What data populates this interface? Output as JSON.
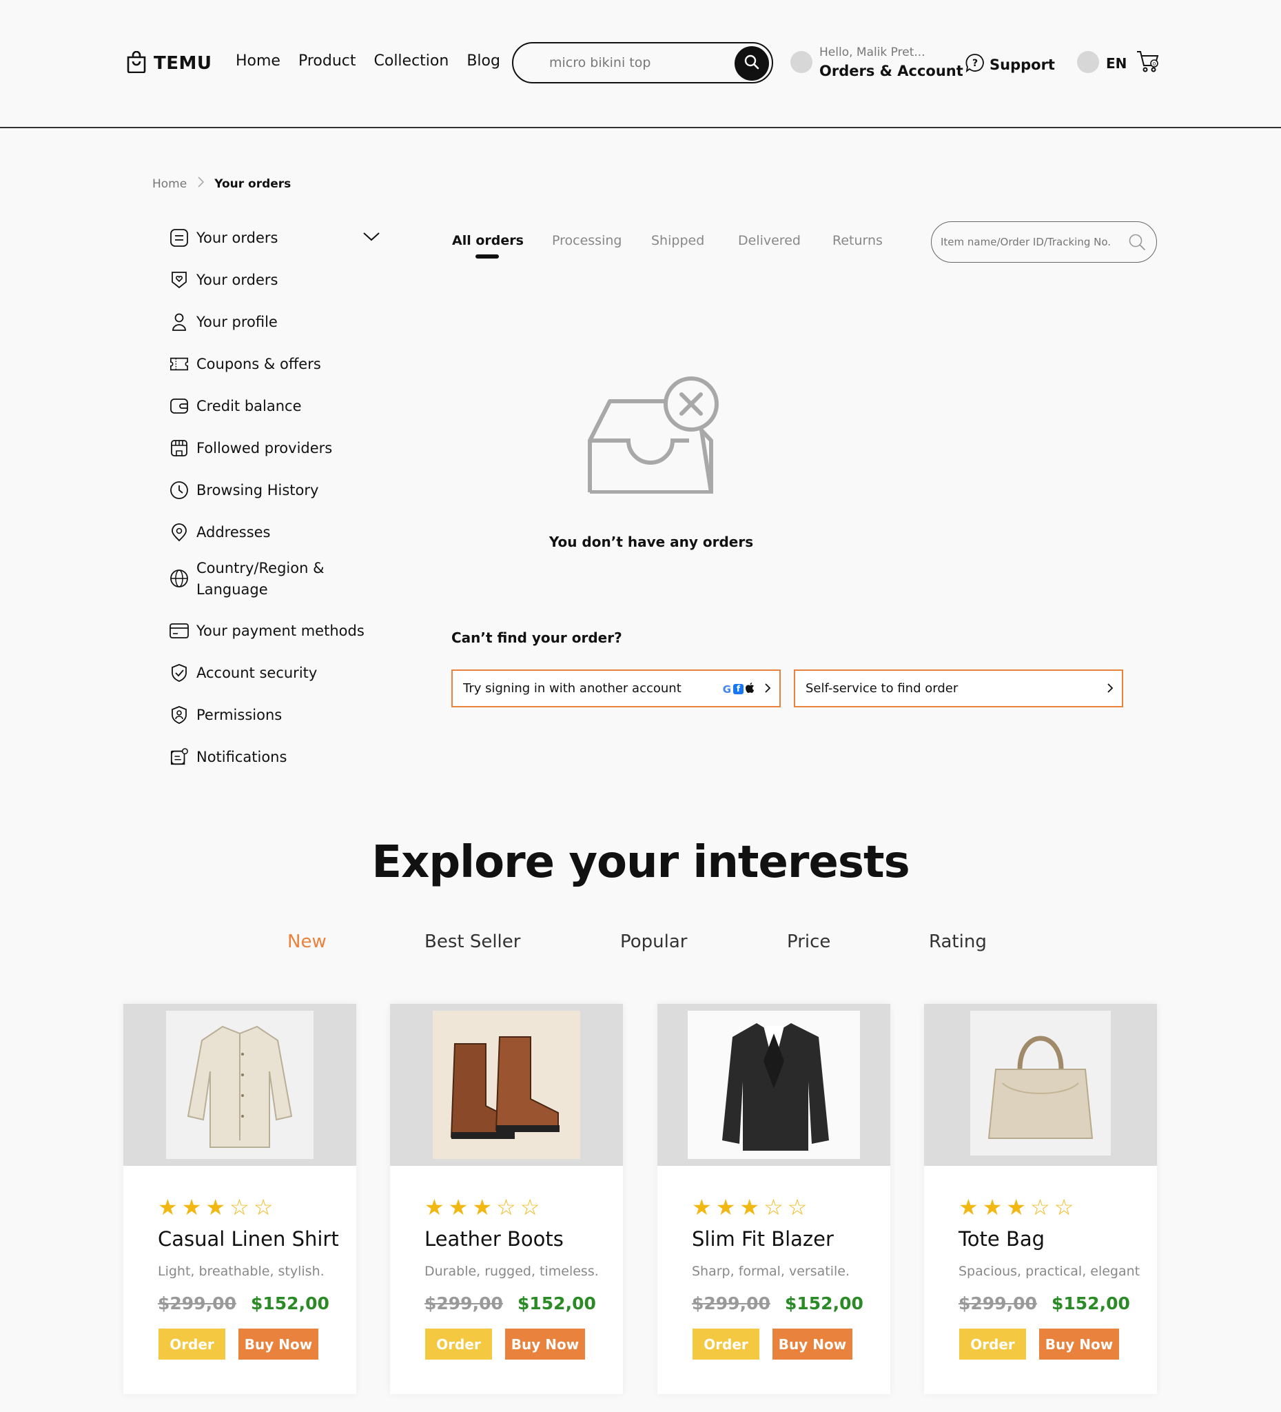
{
  "header": {
    "logo": "TEMU",
    "nav": [
      "Home",
      "Product",
      "Collection",
      "Blog"
    ],
    "search_value": "micro bikini top",
    "greeting": "Hello, Malik Pret...",
    "account_label": "Orders & Account",
    "support_label": "Support",
    "language": "EN"
  },
  "breadcrumb": {
    "home": "Home",
    "current": "Your orders"
  },
  "sidebar": {
    "items": [
      {
        "label": "Your orders",
        "icon": "order-list-icon"
      },
      {
        "label": "Your orders",
        "icon": "heart-shield-icon"
      },
      {
        "label": "Your profile",
        "icon": "user-icon"
      },
      {
        "label": "Coupons & offers",
        "icon": "ticket-icon"
      },
      {
        "label": "Credit balance",
        "icon": "wallet-icon"
      },
      {
        "label": "Followed providers",
        "icon": "store-icon"
      },
      {
        "label": "Browsing History",
        "icon": "clock-icon"
      },
      {
        "label": "Addresses",
        "icon": "location-pin-icon"
      },
      {
        "label": "Country/Region & Language",
        "icon": "globe-icon"
      },
      {
        "label": "Your payment methods",
        "icon": "card-icon"
      },
      {
        "label": "Account security",
        "icon": "shield-check-icon"
      },
      {
        "label": "Permissions",
        "icon": "shield-user-icon"
      },
      {
        "label": "Notifications",
        "icon": "message-icon"
      }
    ]
  },
  "orders": {
    "tabs": [
      "All orders",
      "Processing",
      "Shipped",
      "Delivered",
      "Returns"
    ],
    "search_placeholder": "Item name/Order ID/Tracking No.",
    "empty_text": "You don’t have any orders",
    "cant_find": "Can’t find your order?",
    "help_signin": "Try signing in with another account",
    "help_self_service": "Self-service to find order"
  },
  "explore": {
    "title": "Explore your interests",
    "filters": [
      "New",
      "Best Seller",
      "Popular",
      "Price",
      "Rating"
    ],
    "active_filter": "New",
    "order_label": "Order",
    "buy_label": "Buy Now",
    "products": [
      {
        "name": "Casual Linen Shirt",
        "desc": "Light, breathable, stylish.",
        "old_price": "$299,00",
        "price": "$152,00",
        "rating": 3
      },
      {
        "name": "Leather Boots",
        "desc": "Durable, rugged, timeless.",
        "old_price": "$299,00",
        "price": "$152,00",
        "rating": 3
      },
      {
        "name": "Slim Fit Blazer",
        "desc": "Sharp, formal, versatile.",
        "old_price": "$299,00",
        "price": "$152,00",
        "rating": 3
      },
      {
        "name": "Tote Bag",
        "desc": "Spacious, practical, elegant",
        "old_price": "$299,00",
        "price": "$152,00",
        "rating": 3
      }
    ]
  },
  "colors": {
    "accent": "#e8823d",
    "order_button": "#f5c842",
    "price_green": "#2a8a25",
    "star": "#f1b814"
  }
}
